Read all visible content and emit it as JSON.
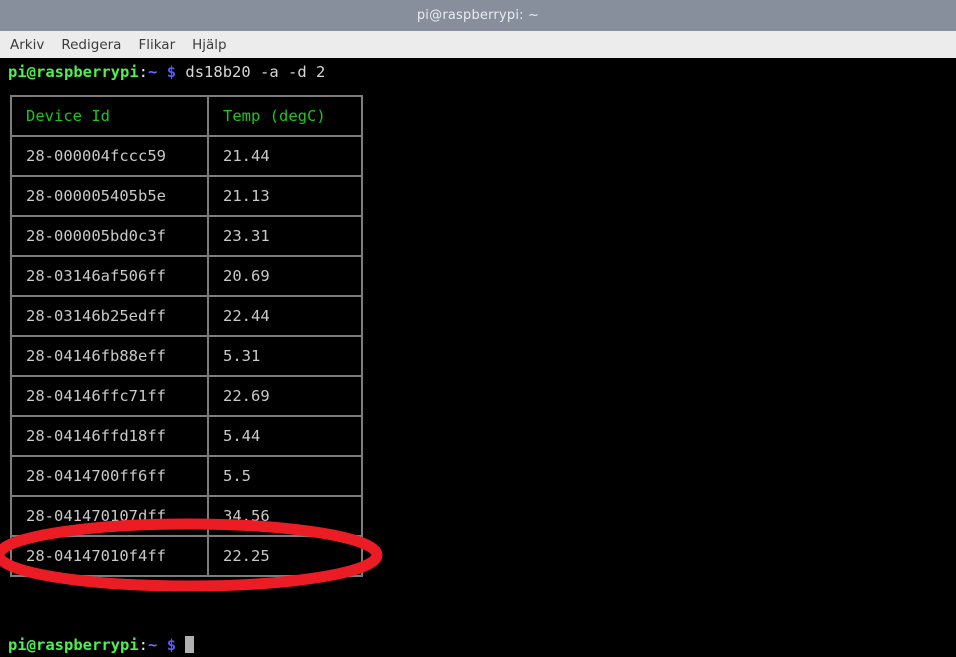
{
  "window": {
    "title": "pi@raspberrypi: ~"
  },
  "menubar": {
    "items": [
      {
        "label": "Arkiv",
        "name": "menu-item-arkiv"
      },
      {
        "label": "Redigera",
        "name": "menu-item-redigera"
      },
      {
        "label": "Flikar",
        "name": "menu-item-flikar"
      },
      {
        "label": "Hjalp",
        "name": "menu-item-hjalp"
      }
    ]
  },
  "terminal": {
    "prompt": {
      "user_host": "pi@raspberrypi",
      "separator": ":",
      "path": "~",
      "symbol": "$"
    },
    "command": " ds18b20 -a -d 2",
    "cursor_visible": true,
    "background_color": "#000000",
    "prompt_user_color": "#4ef14e",
    "prompt_symbol_color": "#5858ff",
    "output_text_color": "#c9c9c9",
    "table_header_color": "#19c819",
    "table_border_color": "#7d7d7d"
  },
  "table": {
    "headers": [
      "Device Id",
      "Temp (degC)"
    ],
    "rows": [
      {
        "device_id": "28-000004fccc59",
        "temp": "21.44"
      },
      {
        "device_id": "28-000005405b5e",
        "temp": "21.13"
      },
      {
        "device_id": "28-000005bd0c3f",
        "temp": "23.31"
      },
      {
        "device_id": "28-03146af506ff",
        "temp": "20.69"
      },
      {
        "device_id": "28-03146b25edff",
        "temp": "22.44"
      },
      {
        "device_id": "28-04146fb88eff",
        "temp": "5.31"
      },
      {
        "device_id": "28-04146ffc71ff",
        "temp": "22.69"
      },
      {
        "device_id": "28-04146ffd18ff",
        "temp": "5.44"
      },
      {
        "device_id": "28-0414700ff6ff",
        "temp": "5.5"
      },
      {
        "device_id": "28-041470107dff",
        "temp": "34.56"
      },
      {
        "device_id": "28-04147010f4ff",
        "temp": "22.25"
      }
    ]
  },
  "annotation": {
    "shape": "ellipse",
    "color": "#ec1c24",
    "highlighted_row_index": 9,
    "highlighted_device_id": "28-041470107dff",
    "highlighted_temp": "34.56"
  }
}
